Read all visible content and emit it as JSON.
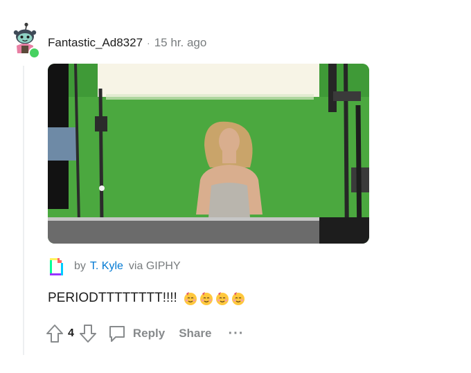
{
  "comment": {
    "author": "Fantastic_Ad8327",
    "separator": "·",
    "timestamp": "15 hr. ago",
    "avatar_icon": "snoo-avatar-icon",
    "online_color": "#46d160",
    "attribution": {
      "prefix": "by",
      "author": "T. Kyle",
      "via": "via GIPHY",
      "link_color": "#0079d3"
    },
    "text": "PERIODTTTTTTTT!!!!",
    "emoji_icon": "partying-face-icon",
    "emoji_count": 4,
    "actions": {
      "score": "4",
      "reply_label": "Reply",
      "share_label": "Share",
      "more_label": "···"
    }
  }
}
